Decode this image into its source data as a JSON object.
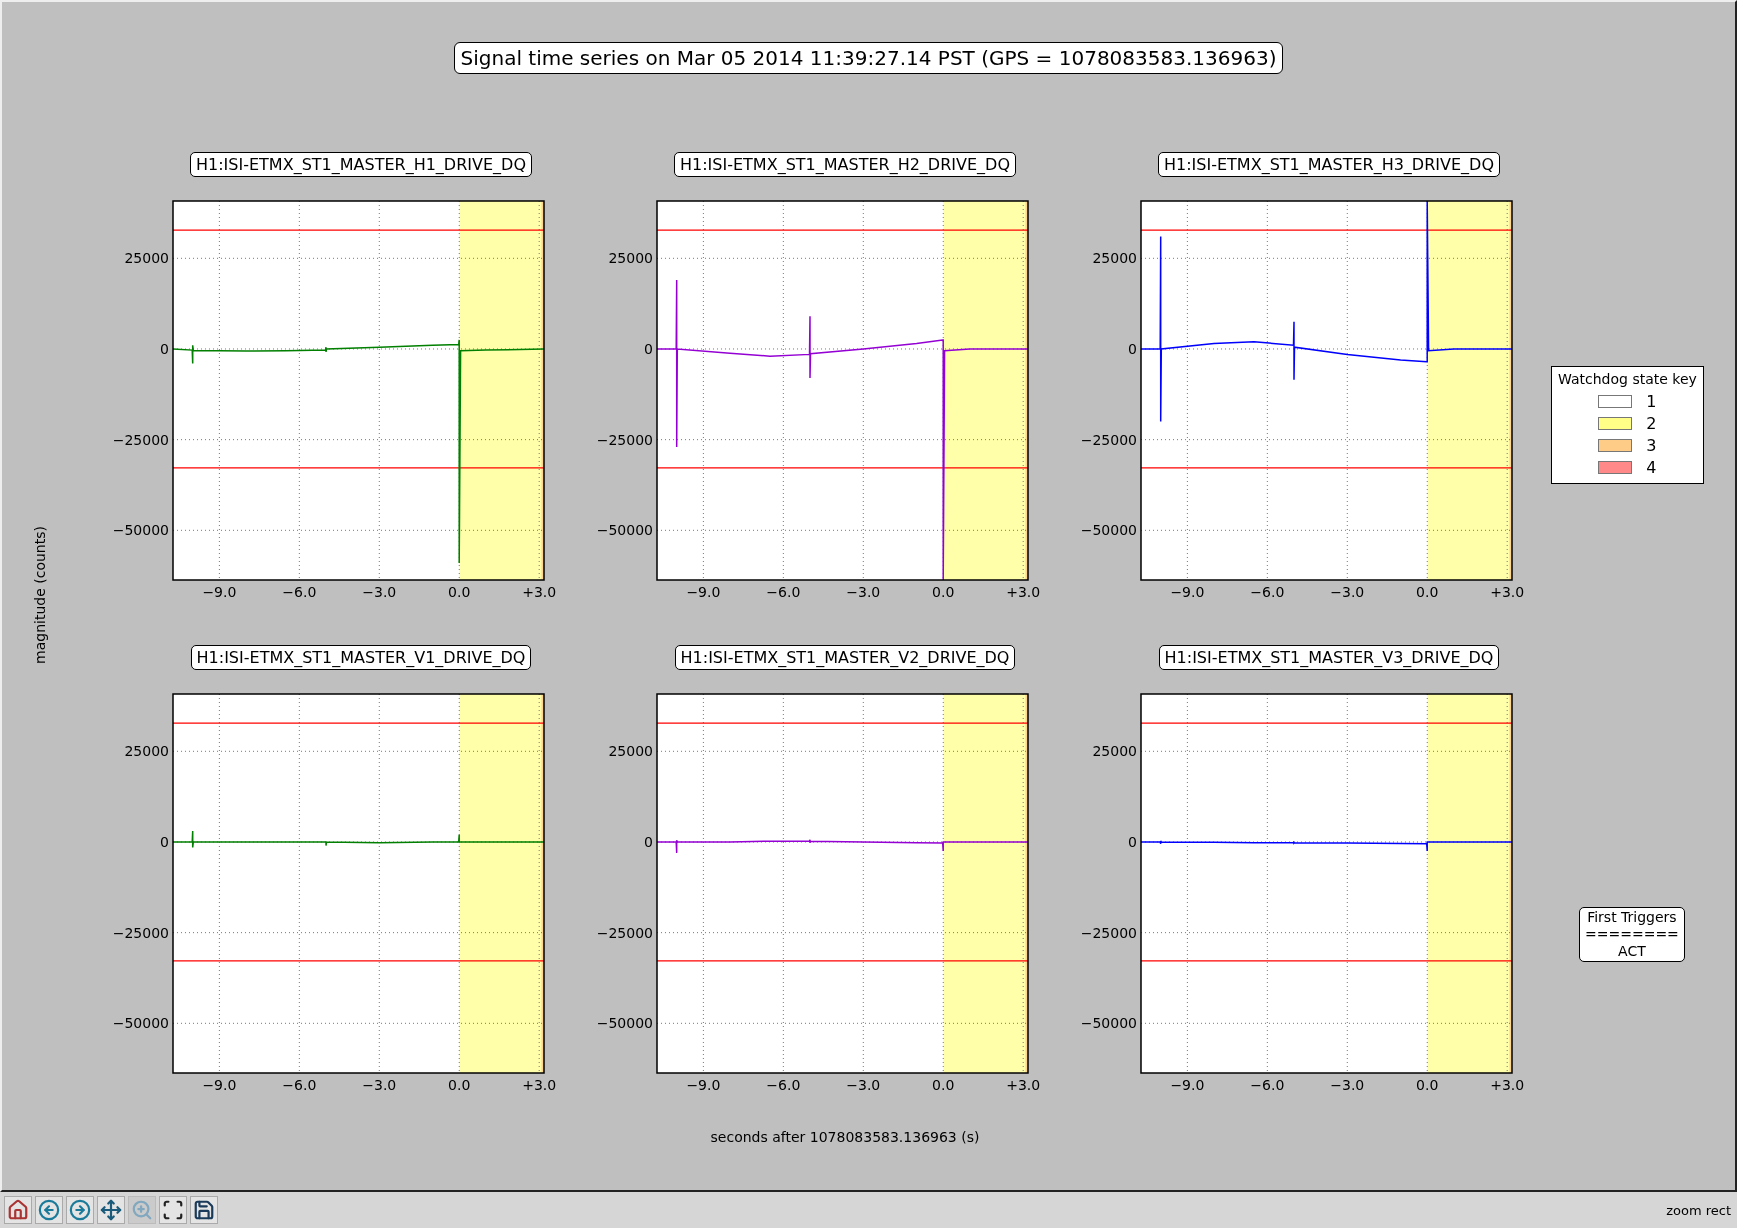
{
  "figure": {
    "title": "Signal time series on Mar 05 2014 11:39:27.14 PST (GPS = 1078083583.136963)",
    "ylabel": "magnitude (counts)",
    "xlabel": "seconds after 1078083583.136963 (s)",
    "subplots": [
      {
        "title": "H1:ISI-ETMX_ST1_MASTER_H1_DRIVE_DQ",
        "chart_data": {
          "type": "line",
          "grid": true,
          "xlim": [
            -10.74,
            3.18
          ],
          "ylim": [
            -63700,
            40800
          ],
          "xticks": [
            {
              "value": -9,
              "label": "−9.0"
            },
            {
              "value": -6,
              "label": "−6.0"
            },
            {
              "value": -3,
              "label": "−3.0"
            },
            {
              "value": 0,
              "label": "0.0"
            },
            {
              "value": 3,
              "label": "+3.0"
            }
          ],
          "yticks": [
            {
              "value": -50000,
              "label": "−50000"
            },
            {
              "value": -25000,
              "label": "−25000"
            },
            {
              "value": 0,
              "label": "0"
            },
            {
              "value": 25000,
              "label": "25000"
            }
          ],
          "x": [
            -10.74,
            -10.02,
            -10,
            -10,
            -9.98,
            -8,
            -6.5,
            -5.02,
            -5,
            -5,
            -4.98,
            -3,
            -1,
            -0.02,
            0,
            0,
            0.05,
            1,
            3.18
          ],
          "series": [
            {
              "color": "#007f00",
              "values": [
                0,
                -300,
                -4000,
                1000,
                -400,
                -600,
                -500,
                -300,
                500,
                -800,
                0,
                500,
                1000,
                1200,
                2500,
                -59000,
                -500,
                -300,
                0
              ]
            }
          ],
          "bands": [
            {
              "axis": "x",
              "from": 0,
              "to": 3.08,
              "color": "#ffffaa"
            },
            {
              "axis": "x",
              "from": 3.08,
              "to": 3.18,
              "color": "#ffd591"
            }
          ],
          "ref_lines": [
            {
              "axis": "y",
              "value": 32767,
              "color": "#ff0000"
            },
            {
              "axis": "y",
              "value": -32767,
              "color": "#ff0000"
            }
          ]
        }
      },
      {
        "title": "H1:ISI-ETMX_ST1_MASTER_H2_DRIVE_DQ",
        "chart_data": {
          "type": "line",
          "grid": true,
          "xlim": [
            -10.74,
            3.18
          ],
          "ylim": [
            -63700,
            40800
          ],
          "xticks": [
            {
              "value": -9,
              "label": "−9.0"
            },
            {
              "value": -6,
              "label": "−6.0"
            },
            {
              "value": -3,
              "label": "−3.0"
            },
            {
              "value": 0,
              "label": "0.0"
            },
            {
              "value": 3,
              "label": "+3.0"
            }
          ],
          "yticks": [
            {
              "value": -50000,
              "label": "−50000"
            },
            {
              "value": -25000,
              "label": "−25000"
            },
            {
              "value": 0,
              "label": "0"
            },
            {
              "value": 25000,
              "label": "25000"
            }
          ],
          "x": [
            -10.74,
            -10.02,
            -10,
            -10,
            -9.98,
            -8,
            -6.5,
            -5.02,
            -5,
            -5,
            -4.98,
            -3,
            -1,
            -0.02,
            0,
            0,
            0.05,
            1,
            3.18
          ],
          "series": [
            {
              "color": "#9400d3",
              "values": [
                0,
                0,
                19000,
                -27000,
                0,
                -1200,
                -2000,
                -1500,
                9000,
                -8000,
                -1300,
                0,
                1500,
                2500,
                2500,
                -63700,
                -500,
                0,
                0
              ]
            }
          ],
          "bands": [
            {
              "axis": "x",
              "from": 0,
              "to": 3.08,
              "color": "#ffffaa"
            },
            {
              "axis": "x",
              "from": 3.08,
              "to": 3.18,
              "color": "#ffd591"
            }
          ],
          "ref_lines": [
            {
              "axis": "y",
              "value": 32767,
              "color": "#ff0000"
            },
            {
              "axis": "y",
              "value": -32767,
              "color": "#ff0000"
            }
          ]
        }
      },
      {
        "title": "H1:ISI-ETMX_ST1_MASTER_H3_DRIVE_DQ",
        "chart_data": {
          "type": "line",
          "grid": true,
          "xlim": [
            -10.74,
            3.18
          ],
          "ylim": [
            -63700,
            40800
          ],
          "xticks": [
            {
              "value": -9,
              "label": "−9.0"
            },
            {
              "value": -6,
              "label": "−6.0"
            },
            {
              "value": -3,
              "label": "−3.0"
            },
            {
              "value": 0,
              "label": "0.0"
            },
            {
              "value": 3,
              "label": "+3.0"
            }
          ],
          "yticks": [
            {
              "value": -50000,
              "label": "−50000"
            },
            {
              "value": -25000,
              "label": "−25000"
            },
            {
              "value": 0,
              "label": "0"
            },
            {
              "value": 25000,
              "label": "25000"
            }
          ],
          "x": [
            -10.74,
            -10.02,
            -10,
            -10,
            -9.98,
            -8,
            -6.5,
            -5.02,
            -5,
            -5,
            -4.98,
            -3,
            -1,
            -0.02,
            0,
            0,
            0.05,
            1,
            3.18
          ],
          "series": [
            {
              "color": "#0000ff",
              "values": [
                0,
                0,
                31000,
                -20000,
                0,
                1500,
                2000,
                1000,
                7500,
                -8500,
                500,
                -1500,
                -3000,
                -3500,
                -3500,
                40800,
                -500,
                0,
                0
              ]
            }
          ],
          "bands": [
            {
              "axis": "x",
              "from": 0,
              "to": 3.08,
              "color": "#ffffaa"
            },
            {
              "axis": "x",
              "from": 3.08,
              "to": 3.18,
              "color": "#ffd591"
            }
          ],
          "ref_lines": [
            {
              "axis": "y",
              "value": 32767,
              "color": "#ff0000"
            },
            {
              "axis": "y",
              "value": -32767,
              "color": "#ff0000"
            }
          ]
        }
      },
      {
        "title": "H1:ISI-ETMX_ST1_MASTER_V1_DRIVE_DQ",
        "chart_data": {
          "type": "line",
          "grid": true,
          "xlim": [
            -10.74,
            3.18
          ],
          "ylim": [
            -63700,
            40800
          ],
          "xticks": [
            {
              "value": -9,
              "label": "−9.0"
            },
            {
              "value": -6,
              "label": "−6.0"
            },
            {
              "value": -3,
              "label": "−3.0"
            },
            {
              "value": 0,
              "label": "0.0"
            },
            {
              "value": 3,
              "label": "+3.0"
            }
          ],
          "yticks": [
            {
              "value": -50000,
              "label": "−50000"
            },
            {
              "value": -25000,
              "label": "−25000"
            },
            {
              "value": 0,
              "label": "0"
            },
            {
              "value": 25000,
              "label": "25000"
            }
          ],
          "x": [
            -10.74,
            -10.02,
            -10,
            -10,
            -9.98,
            -8,
            -6.5,
            -5.02,
            -5,
            -5,
            -4.98,
            -3,
            -1,
            -0.02,
            0,
            0,
            0.05,
            1,
            3.18
          ],
          "series": [
            {
              "color": "#007f00",
              "values": [
                0,
                0,
                3000,
                -1500,
                0,
                0,
                0,
                0,
                0,
                -1000,
                0,
                -200,
                0,
                0,
                2000,
                0,
                0,
                0,
                0
              ]
            }
          ],
          "bands": [
            {
              "axis": "x",
              "from": 0,
              "to": 3.08,
              "color": "#ffffaa"
            },
            {
              "axis": "x",
              "from": 3.08,
              "to": 3.18,
              "color": "#ffd591"
            }
          ],
          "ref_lines": [
            {
              "axis": "y",
              "value": 32767,
              "color": "#ff0000"
            },
            {
              "axis": "y",
              "value": -32767,
              "color": "#ff0000"
            }
          ]
        }
      },
      {
        "title": "H1:ISI-ETMX_ST1_MASTER_V2_DRIVE_DQ",
        "chart_data": {
          "type": "line",
          "grid": true,
          "xlim": [
            -10.74,
            3.18
          ],
          "ylim": [
            -63700,
            40800
          ],
          "xticks": [
            {
              "value": -9,
              "label": "−9.0"
            },
            {
              "value": -6,
              "label": "−6.0"
            },
            {
              "value": -3,
              "label": "−3.0"
            },
            {
              "value": 0,
              "label": "0.0"
            },
            {
              "value": 3,
              "label": "+3.0"
            }
          ],
          "yticks": [
            {
              "value": -50000,
              "label": "−50000"
            },
            {
              "value": -25000,
              "label": "−25000"
            },
            {
              "value": 0,
              "label": "0"
            },
            {
              "value": 25000,
              "label": "25000"
            }
          ],
          "x": [
            -10.74,
            -10.02,
            -10,
            -10,
            -9.98,
            -8,
            -6.5,
            -5.02,
            -5,
            -5,
            -4.98,
            -3,
            -1,
            -0.02,
            0,
            0,
            0.05,
            1,
            3.18
          ],
          "series": [
            {
              "color": "#9400d3",
              "values": [
                0,
                0,
                -3000,
                500,
                0,
                0,
                200,
                200,
                600,
                -200,
                200,
                0,
                -200,
                -300,
                -2500,
                0,
                0,
                0,
                0
              ]
            }
          ],
          "bands": [
            {
              "axis": "x",
              "from": 0,
              "to": 3.08,
              "color": "#ffffaa"
            },
            {
              "axis": "x",
              "from": 3.08,
              "to": 3.18,
              "color": "#ffd591"
            }
          ],
          "ref_lines": [
            {
              "axis": "y",
              "value": 32767,
              "color": "#ff0000"
            },
            {
              "axis": "y",
              "value": -32767,
              "color": "#ff0000"
            }
          ]
        }
      },
      {
        "title": "H1:ISI-ETMX_ST1_MASTER_V3_DRIVE_DQ",
        "chart_data": {
          "type": "line",
          "grid": true,
          "xlim": [
            -10.74,
            3.18
          ],
          "ylim": [
            -63700,
            40800
          ],
          "xticks": [
            {
              "value": -9,
              "label": "−9.0"
            },
            {
              "value": -6,
              "label": "−6.0"
            },
            {
              "value": -3,
              "label": "−3.0"
            },
            {
              "value": 0,
              "label": "0.0"
            },
            {
              "value": 3,
              "label": "+3.0"
            }
          ],
          "yticks": [
            {
              "value": -50000,
              "label": "−50000"
            },
            {
              "value": -25000,
              "label": "−25000"
            },
            {
              "value": 0,
              "label": "0"
            },
            {
              "value": 25000,
              "label": "25000"
            }
          ],
          "x": [
            -10.74,
            -10.02,
            -10,
            -10,
            -9.98,
            -8,
            -6.5,
            -5.02,
            -5,
            -5,
            -4.98,
            -3,
            -1,
            -0.02,
            0,
            0,
            0.05,
            1,
            3.18
          ],
          "series": [
            {
              "color": "#0000ff",
              "values": [
                0,
                0,
                -500,
                300,
                0,
                -100,
                -200,
                -200,
                100,
                -300,
                -200,
                -300,
                -400,
                -500,
                -2500,
                0,
                0,
                0,
                0
              ]
            }
          ],
          "bands": [
            {
              "axis": "x",
              "from": 0,
              "to": 3.08,
              "color": "#ffffaa"
            },
            {
              "axis": "x",
              "from": 3.08,
              "to": 3.18,
              "color": "#ffd591"
            }
          ],
          "ref_lines": [
            {
              "axis": "y",
              "value": 32767,
              "color": "#ff0000"
            },
            {
              "axis": "y",
              "value": -32767,
              "color": "#ff0000"
            }
          ]
        }
      }
    ],
    "legend": {
      "title": "Watchdog state key",
      "items": [
        {
          "label": "1",
          "color": "#ffffff"
        },
        {
          "label": "2",
          "color": "#ffff88"
        },
        {
          "label": "3",
          "color": "#ffcc88"
        },
        {
          "label": "4",
          "color": "#ff8888"
        }
      ]
    },
    "triggers": {
      "title": "First Triggers",
      "separator": "========",
      "items": [
        "ACT"
      ]
    }
  },
  "toolbar": {
    "buttons": [
      {
        "kind": "home",
        "selected": false
      },
      {
        "kind": "back",
        "selected": false
      },
      {
        "kind": "forward",
        "selected": false
      },
      {
        "kind": "pan",
        "selected": false
      },
      {
        "kind": "zoom",
        "selected": true
      },
      {
        "kind": "subplots",
        "selected": false
      },
      {
        "kind": "save",
        "selected": false
      }
    ],
    "status": "zoom rect"
  }
}
